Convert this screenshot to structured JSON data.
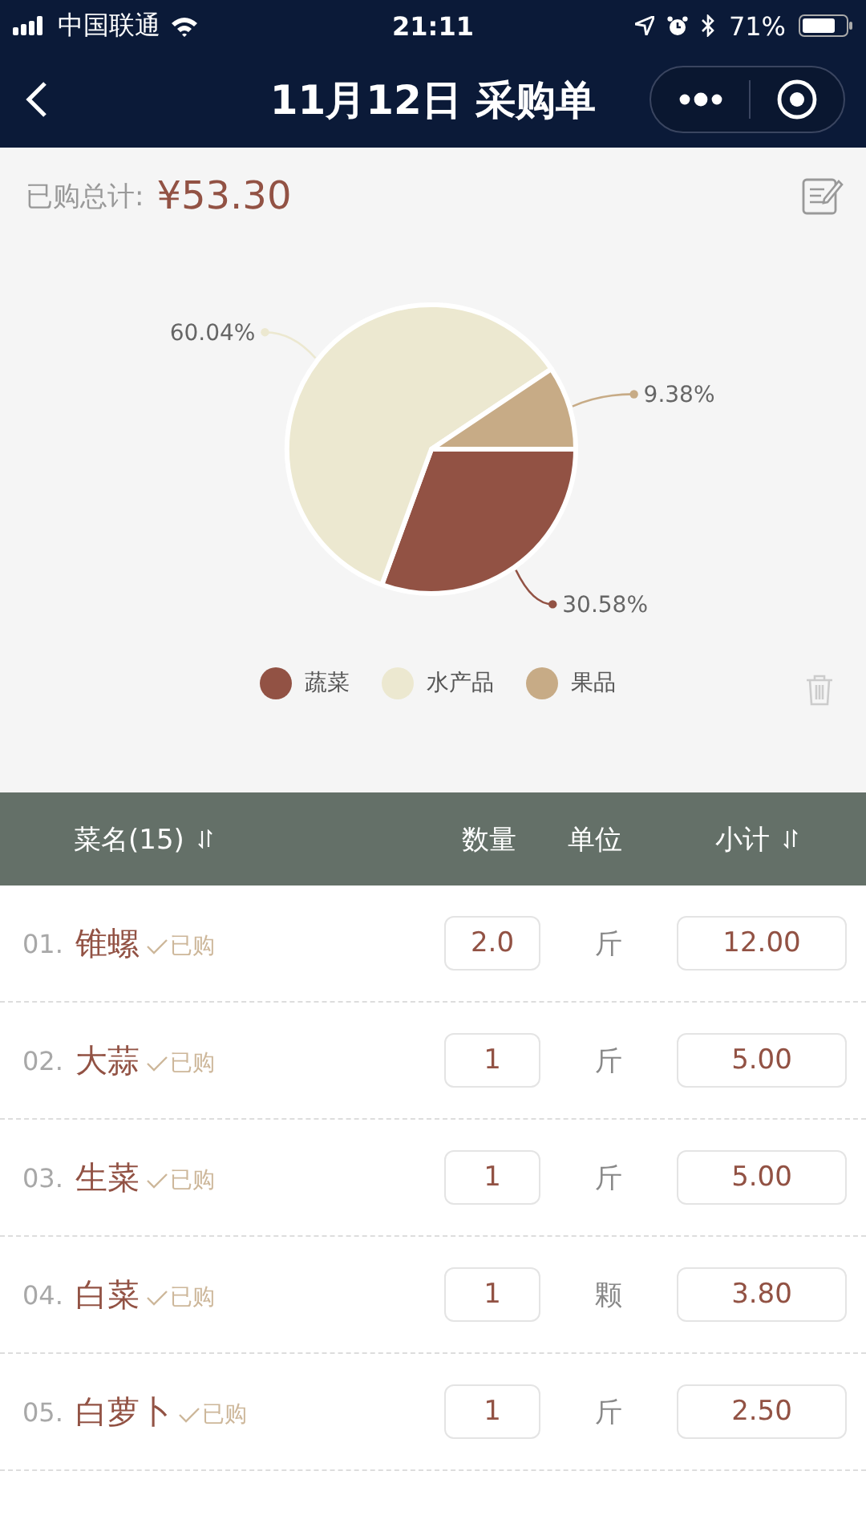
{
  "status_bar": {
    "carrier": "中国联通",
    "time": "21:11",
    "battery": "71%"
  },
  "nav": {
    "title": "11月12日 采购单"
  },
  "summary": {
    "label": "已购总计:",
    "total": "¥53.30"
  },
  "chart": {
    "chart_data": {
      "type": "pie",
      "categories": [
        "蔬菜",
        "水产品",
        "果品"
      ],
      "values": [
        30.58,
        60.04,
        9.38
      ],
      "value_labels": [
        "30.58%",
        "60.04%",
        "9.38%"
      ]
    },
    "legend": [
      {
        "color": "#925244"
      },
      {
        "color": "#ece8d0"
      },
      {
        "color": "#c7ab86"
      }
    ]
  },
  "table": {
    "columns": [
      {
        "label": "菜名(15)",
        "sortable": true
      },
      {
        "label": "数量",
        "sortable": false
      },
      {
        "label": "单位",
        "sortable": false
      },
      {
        "label": "小计",
        "sortable": true
      }
    ],
    "rows": [
      {
        "index": "01.",
        "name": "锥螺",
        "status": "已购",
        "qty": "2.0",
        "unit": "斤",
        "subtotal": "12.00"
      },
      {
        "index": "02.",
        "name": "大蒜",
        "status": "已购",
        "qty": "1",
        "unit": "斤",
        "subtotal": "5.00"
      },
      {
        "index": "03.",
        "name": "生菜",
        "status": "已购",
        "qty": "1",
        "unit": "斤",
        "subtotal": "5.00"
      },
      {
        "index": "04.",
        "name": "白菜",
        "status": "已购",
        "qty": "1",
        "unit": "颗",
        "subtotal": "3.80"
      },
      {
        "index": "05.",
        "name": "白萝卜",
        "status": "已购",
        "qty": "1",
        "unit": "斤",
        "subtotal": "2.50"
      }
    ]
  }
}
